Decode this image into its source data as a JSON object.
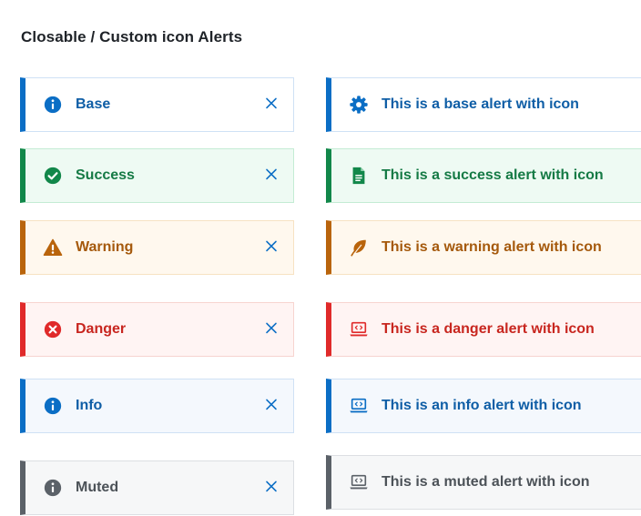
{
  "heading": "Closable / Custom icon Alerts",
  "closable_alerts": [
    {
      "variant": "base",
      "label": "Base",
      "icon": "info-circle-icon"
    },
    {
      "variant": "success",
      "label": "Success",
      "icon": "check-circle-icon"
    },
    {
      "variant": "warning",
      "label": "Warning",
      "icon": "warning-triangle-icon"
    },
    {
      "variant": "danger",
      "label": "Danger",
      "icon": "x-circle-icon"
    },
    {
      "variant": "info",
      "label": "Info",
      "icon": "info-circle-icon"
    },
    {
      "variant": "muted",
      "label": "Muted",
      "icon": "info-circle-icon"
    }
  ],
  "custom_icon_alerts": [
    {
      "variant": "base",
      "label": "This is a base alert with icon",
      "icon": "gear-icon"
    },
    {
      "variant": "success",
      "label": "This is a success alert with icon",
      "icon": "document-icon"
    },
    {
      "variant": "warning",
      "label": "This is a warning alert with icon",
      "icon": "leaf-icon"
    },
    {
      "variant": "danger",
      "label": "This is a danger alert with icon",
      "icon": "laptop-code-icon"
    },
    {
      "variant": "info",
      "label": "This is an info alert with icon",
      "icon": "laptop-code-icon"
    },
    {
      "variant": "muted",
      "label": "This is a muted alert with icon",
      "icon": "laptop-code-icon"
    }
  ],
  "close_icon": "close-icon",
  "colors": {
    "base": "#0b6ec5",
    "success": "#12874a",
    "warning": "#b9640c",
    "danger": "#e02a2a",
    "info": "#0b6ec5",
    "muted": "#5b6168",
    "close": "#0b6ec5"
  }
}
